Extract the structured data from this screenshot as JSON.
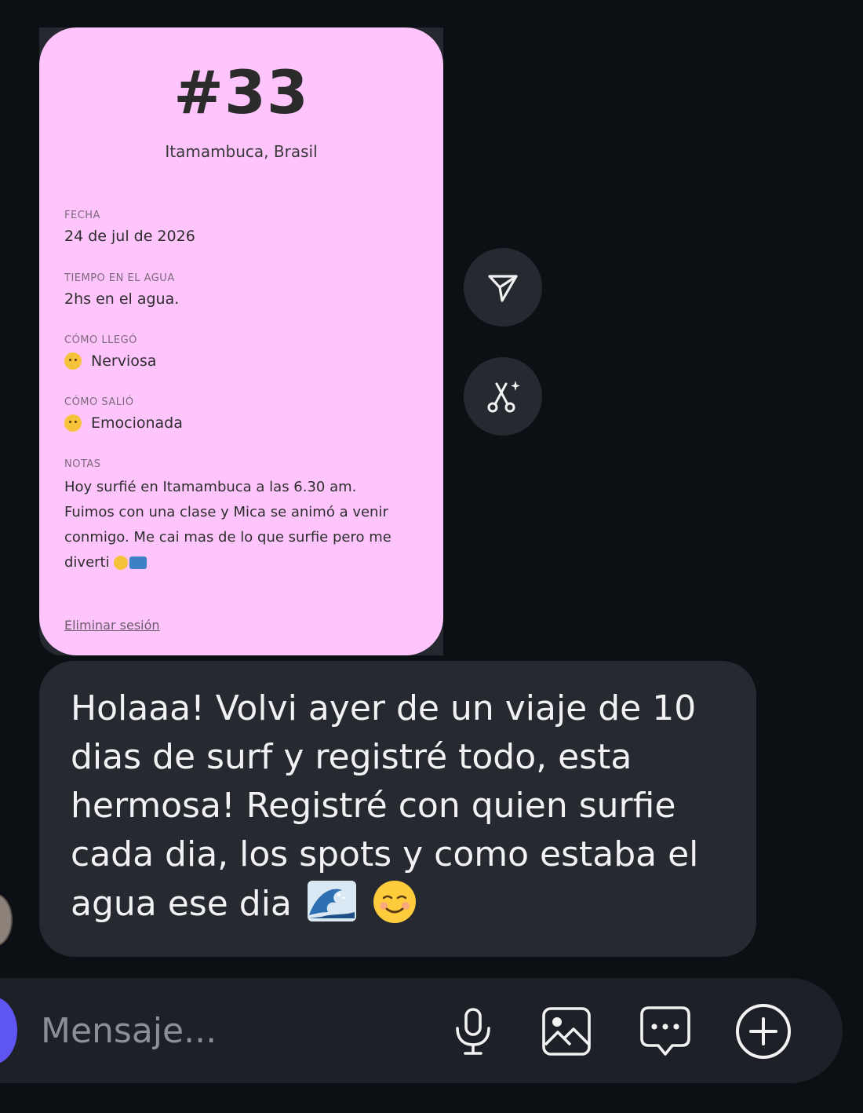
{
  "card": {
    "number": "#33",
    "location": "Itamambuca, Brasil",
    "fields": [
      {
        "label": "FECHA",
        "value": "24 de jul de 2026"
      },
      {
        "label": "TIEMPO EN EL AGUA",
        "value": "2hs en el agua."
      },
      {
        "label": "CÓMO LLEGÓ",
        "value": "Nerviosa",
        "icon": "nervous-face-emoji"
      },
      {
        "label": "CÓMO SALIÓ",
        "value": "Emocionada",
        "icon": "star-struck-emoji"
      }
    ],
    "notes_label": "NOTAS",
    "notes_lines": [
      "Hoy surfié en Itamambuca a las 6.30 am.",
      "Fuimos con una clase y Mica se animó a venir",
      "conmigo. Me cai mas de lo que surfie pero me",
      "diverti"
    ],
    "delete_label": "Eliminar sesión"
  },
  "actions": {
    "share_icon": "send-icon",
    "remix_icon": "scissors-sparkle-icon"
  },
  "message": {
    "lines": [
      "Holaaa! Volvi ayer de un viaje de 10",
      "dias de surf y registré todo, esta",
      "hermosa! Registré con quien surfie",
      "cada dia, los spots y como estaba el",
      "agua ese dia"
    ],
    "trailing_emojis": [
      "wave-emoji",
      "smiling-face-emoji"
    ]
  },
  "composer": {
    "placeholder": "Mensaje...",
    "tools": [
      "microphone-icon",
      "image-icon",
      "sticker-chat-icon",
      "add-circle-icon"
    ]
  },
  "colors": {
    "background": "#0c0f14",
    "card": "#fec4fc",
    "bubble": "#262a30",
    "composer": "#1d2026",
    "accent": "#5e55f2"
  }
}
